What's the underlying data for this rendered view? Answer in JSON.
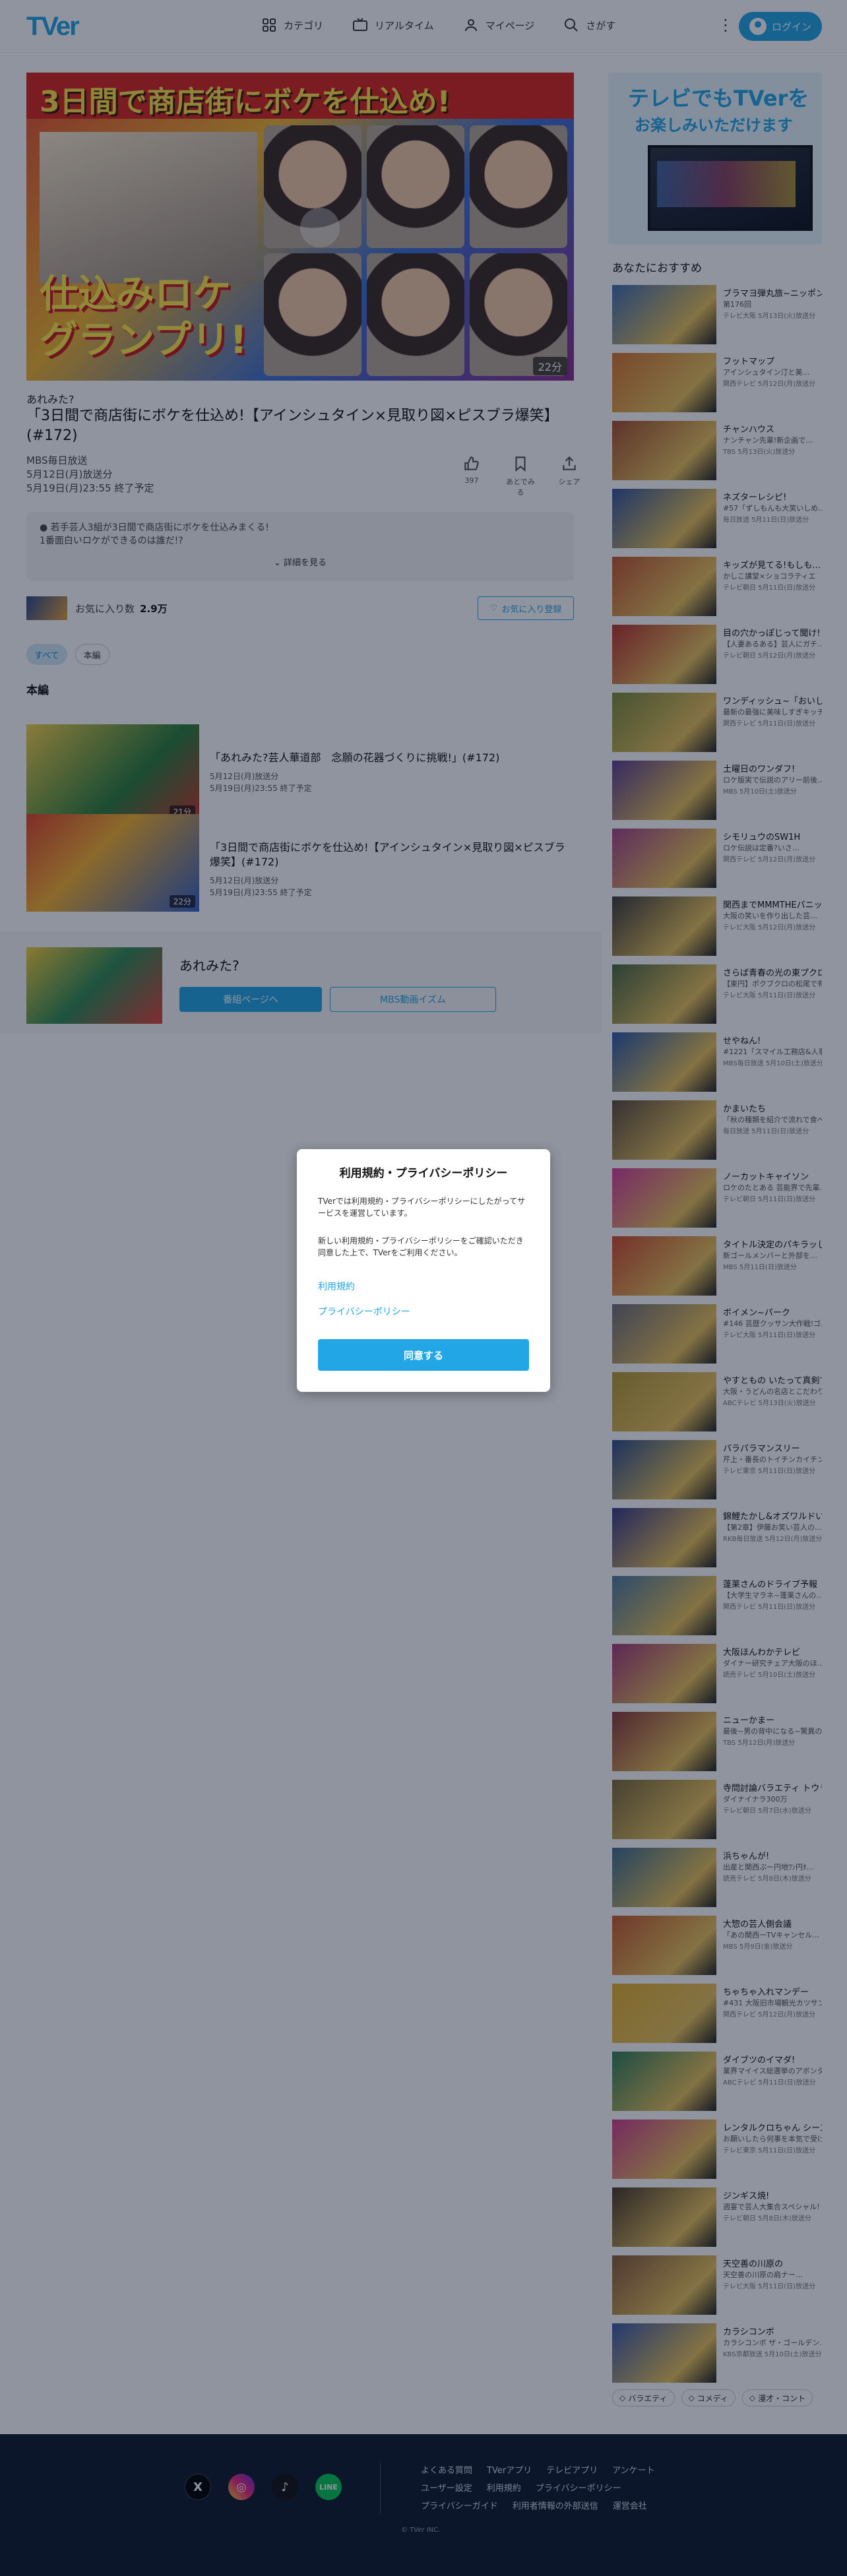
{
  "header": {
    "logo": "TVer",
    "nav": [
      {
        "label": "カテゴリ",
        "icon": "grid-icon"
      },
      {
        "label": "リアルタイム",
        "icon": "tv-icon"
      },
      {
        "label": "マイページ",
        "icon": "user-icon"
      },
      {
        "label": "さがす",
        "icon": "search-icon"
      }
    ],
    "login_label": "ログイン"
  },
  "hero": {
    "overlay_title": "3日間で商店街にボケを仕込め!",
    "overlay_logo_1": "仕込みロケ",
    "overlay_logo_2": "グランプリ!",
    "duration": "22分"
  },
  "episode": {
    "series": "あれみた?",
    "title": "「3日間で商店街にボケを仕込め!【アインシュタイン×見取り図×ピスブラ爆笑】(#172)",
    "broadcaster": "MBS毎日放送",
    "aired": "5月12日(月)放送分",
    "expires": "5月19日(月)23:55 終了予定",
    "actions": [
      {
        "label": "いいね",
        "count": "397",
        "icon": "thumbs-up-icon"
      },
      {
        "label": "あとでみる",
        "icon": "bookmark-icon"
      },
      {
        "label": "シェア",
        "icon": "share-icon"
      }
    ],
    "desc_line1": "● 若手芸人3組が3日間で商店街にボケを仕込みまくる!",
    "desc_line2": "1番面白いロケができるのは誰だ!?",
    "more": "詳細を見る"
  },
  "favorites": {
    "label": "お気に入り数",
    "count": "2.9万",
    "button": "お気に入り登録"
  },
  "filters": [
    "すべて",
    "本編"
  ],
  "section_label": "本編",
  "episodes": [
    {
      "title": "「あれみた?芸人華道部　念願の花器づくりに挑戦!」(#172)",
      "aired": "5月12日(月)放送分",
      "expires": "5月19日(月)23:55 終了予定",
      "duration": "21分"
    },
    {
      "title": "「3日間で商店街にボケを仕込め!【アインシュタイン×見取り図×ピスブラ爆笑】(#172)",
      "aired": "5月12日(月)放送分",
      "expires": "5月19日(月)23:55 終了予定",
      "duration": "22分"
    }
  ],
  "series_banner": {
    "name": "あれみた?",
    "program_button": "番組ページへ",
    "mbs_button": "MBS動画イズム"
  },
  "sidebar": {
    "ad_line1": "テレビでもTVerを",
    "ad_line2": "お楽しみいただけます",
    "rec_title": "あなたにおすすめ",
    "items": [
      {
        "t": "ブラマヨ弾丸旅~ニッポン…",
        "s": "第176回",
        "m": "テレビ大阪 5月13日(火)放送分",
        "c": "#3f6fb0"
      },
      {
        "t": "フットマップ",
        "s": "アインシュタイン汀と美…",
        "m": "関西テレビ 5月12日(月)放送分",
        "c": "#d5742e"
      },
      {
        "t": "チャンハウス",
        "s": "ナンチャン先輩!新企画で…",
        "m": "TBS 5月13日(火)放送分",
        "c": "#a44f2d"
      },
      {
        "t": "ネズターレシピ!",
        "s": "#57「ずしもんも大笑いしめ…",
        "m": "毎日放送 5月11日(日)放送分",
        "c": "#32559a"
      },
      {
        "t": "キッズが見てる!もしも…",
        "s": "かしこ講堂×ショコラティエ",
        "m": "テレビ朝日 5月11日(日)放送分",
        "c": "#c2562f"
      },
      {
        "t": "目の穴かっぽじって聞け!",
        "s": "【人妻あるある】芸人にガチ…",
        "m": "テレビ朝日 5月12日(月)放送分",
        "c": "#b8322c"
      },
      {
        "t": "ワンディッシュ~「おいし…",
        "s": "最新の最強に美味しすぎキッチン…",
        "m": "関西テレビ 5月11日(日)放送分",
        "c": "#7a8a3a"
      },
      {
        "t": "土曜日のワンダフ!",
        "s": "ロケ版実で伝説のアリー前後…",
        "m": "MBS 5月10日(土)放送分",
        "c": "#5c3f8f"
      },
      {
        "t": "シモリュウのSW1H",
        "s": "ロケ伝説は定番?いさ…",
        "m": "関西テレビ 5月12日(月)放送分",
        "c": "#a54488"
      },
      {
        "t": "関西までMMMTHEパニッ…",
        "s": "大阪の笑いを作り出した芸…",
        "m": "テレビ大阪 5月12日(月)放送分",
        "c": "#3b3b3b"
      },
      {
        "t": "さらば青春の光の東プクロ…",
        "s": "【東円】ポクブクロの松尾で有名…",
        "m": "テレビ大阪 5月11日(日)放送分",
        "c": "#4a6840"
      },
      {
        "t": "せやねん!",
        "s": "#1221「スマイル工務店&人事…",
        "m": "MBS毎日放送 5月10日(土)放送分",
        "c": "#2c5aa8"
      },
      {
        "t": "かまいたち",
        "s": "「秋の種類を紹介で流れで食べて…",
        "m": "毎日放送 5月11日(日)放送分",
        "c": "#5b4d3e"
      },
      {
        "t": "ノーカットキャイソン",
        "s": "ロケのたとある  芸能界で先輩…",
        "m": "テレビ朝日 5月11日(日)放送分",
        "c": "#d63e9b"
      },
      {
        "t": "タイトル決定のパキラッし…",
        "s": "新ゴールメンバーと外部を…",
        "m": "MBS 5月11日(日)放送分",
        "c": "#cf4a2d"
      },
      {
        "t": "ボイメン~パーク",
        "s": "#146 芸歴クッサン大作戦!ゴ…",
        "m": "テレビ大阪 5月11日(日)放送分",
        "c": "#6e6e7a"
      },
      {
        "t": "やすともの いたって真剣です",
        "s": "大阪・うどんの名店とこだわりの…",
        "m": "ABCテレビ 5月13日(火)放送分",
        "c": "#b59a35"
      },
      {
        "t": "パラパラマンスリー",
        "s": "芹上・番長のトイチンカイチン…",
        "m": "テレビ東京 5月11日(日)放送分",
        "c": "#2e4f8a"
      },
      {
        "t": "錦鯉たかし&オズワルドいい…",
        "s": "【第2章】伊藤お笑い芸人の…",
        "m": "RKB毎日放送 5月12日(月)放送分",
        "c": "#3a3a88"
      },
      {
        "t": "蓬莱さんのドライブ予報",
        "s": "【大学生マラネ~蓬莱さんの…",
        "m": "関西テレビ 5月11日(日)放送分",
        "c": "#4d7aa0"
      },
      {
        "t": "大阪ほんわかテレビ",
        "s": "ダイナー研究チェア大阪のほ…",
        "m": "読売テレビ 5月10日(土)放送分",
        "c": "#a33a78"
      },
      {
        "t": "ニューかまー",
        "s": "最後~男の背中になる~驚異の…",
        "m": "TBS 5月12日(月)放送分",
        "c": "#8a3a3a"
      },
      {
        "t": "寺問討論バラエティ トウラ…",
        "s": "ダイナイナラ300万",
        "m": "テレビ朝日 5月7日(水)放送分",
        "c": "#7a6a3a"
      },
      {
        "t": "浜ちゃんが!",
        "s": "出産と関西ぷー円地ﾜﾝ円ﾀ…",
        "m": "読売テレビ 5月8日(木)放送分",
        "c": "#3e6e8e"
      },
      {
        "t": "大惣の芸人側会議",
        "s": "「あの関西一TVキャンセル…",
        "m": "MBS 5月9日(金)放送分",
        "c": "#c65a2c"
      },
      {
        "t": "ちゃちゃ入れマンデー",
        "s": "#431 大阪旧市場観光カツサンド…",
        "m": "関西テレビ 5月12日(月)放送分",
        "c": "#e3b12d"
      },
      {
        "t": "ダイブツのイマダ!",
        "s": "業界マイイス総選挙のアボンタちゃ…",
        "m": "ABCテレビ 5月11日(日)放送分",
        "c": "#2f7f5a"
      },
      {
        "t": "レンタルクロちゃん シーズ…",
        "s": "お願いしたら何事を本気で受けて…",
        "m": "テレビ東京 5月11日(日)放送分",
        "c": "#cf3e8e"
      },
      {
        "t": "ジンギス焼!",
        "s": "週宴で芸人大集合スペシャル!",
        "m": "テレビ朝日 5月8日(木)放送分",
        "c": "#4a3a2a"
      },
      {
        "t": "天空善の川原の",
        "s": "天空善の川原の肩ナー…",
        "m": "テレビ大阪 5月11日(日)放送分",
        "c": "#8a5a3a"
      },
      {
        "t": "カラシコンボ",
        "s": "カラシコンボ ザ・ゴールデン…",
        "m": "KBS京都放送 5月10日(土)放送分",
        "c": "#3a5aa8"
      }
    ],
    "genres": [
      "バラエティ",
      "コメディ",
      "漫才・コント"
    ]
  },
  "footer": {
    "social": [
      "X",
      "Instagram",
      "TikTok",
      "LINE"
    ],
    "links": [
      "よくある質問",
      "TVerアプリ",
      "テレビアプリ",
      "アンケート",
      "ユーザー設定",
      "利用規約",
      "プライバシーポリシー",
      "プライバシーガイド",
      "利用者情報の外部送信",
      "運営会社"
    ],
    "copyright": "© TVer INC."
  },
  "modal": {
    "title": "利用規約・プライバシーポリシー",
    "p1": "TVerでは利用規約・プライバシーポリシーにしたがってサービスを運営しています。",
    "p2": "新しい利用規約・プライバシーポリシーをご確認いただき同意した上で、TVerをご利用ください。",
    "link1": "利用規約",
    "link2": "プライバシーポリシー",
    "agree": "同意する"
  }
}
